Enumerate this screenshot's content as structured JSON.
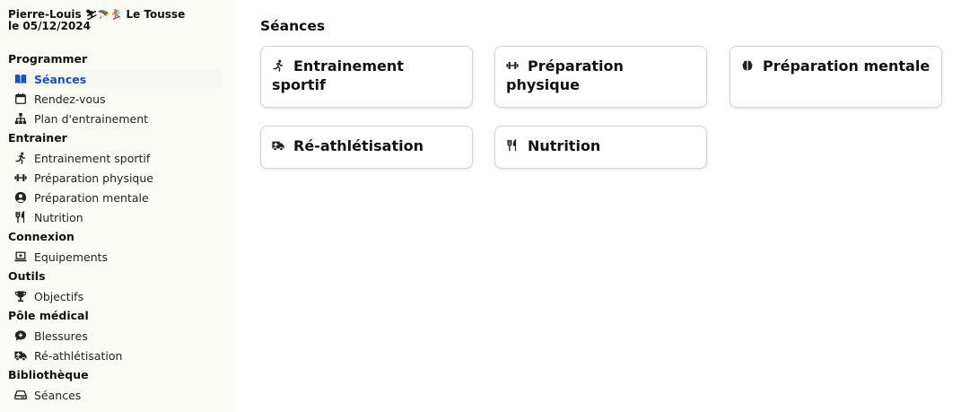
{
  "user": {
    "line1_name": "Pierre-Louis",
    "line1_emoji": "⛷🪂🏂",
    "line1_place": "Le Tousse",
    "line2": "le 05/12/2024"
  },
  "sidebar": {
    "sections": [
      {
        "title": "Programmer",
        "items": [
          {
            "label": "Séances",
            "icon": "book-icon",
            "active": true
          },
          {
            "label": "Rendez-vous",
            "icon": "calendar-icon"
          },
          {
            "label": "Plan d'entrainement",
            "icon": "sitemap-icon"
          }
        ]
      },
      {
        "title": "Entrainer",
        "items": [
          {
            "label": "Entrainement sportif",
            "icon": "running-icon"
          },
          {
            "label": "Préparation physique",
            "icon": "dumbbell-icon"
          },
          {
            "label": "Préparation mentale",
            "icon": "user-circle-icon"
          },
          {
            "label": "Nutrition",
            "icon": "utensils-icon"
          }
        ]
      },
      {
        "title": "Connexion",
        "items": [
          {
            "label": "Equipements",
            "icon": "laptop-icon"
          }
        ]
      },
      {
        "title": "Outils",
        "items": [
          {
            "label": "Objectifs",
            "icon": "trophy-icon"
          }
        ]
      },
      {
        "title": "Pôle médical",
        "items": [
          {
            "label": "Blessures",
            "icon": "comment-medical-icon"
          },
          {
            "label": "Ré-athlétisation",
            "icon": "ambulance-icon"
          }
        ]
      },
      {
        "title": "Bibliothèque",
        "items": [
          {
            "label": "Séances",
            "icon": "hdd-icon"
          }
        ]
      }
    ]
  },
  "main": {
    "title": "Séances",
    "cards": [
      {
        "label": "Entrainement sportif",
        "icon": "running-icon"
      },
      {
        "label": "Préparation physique",
        "icon": "dumbbell-icon"
      },
      {
        "label": "Préparation mentale",
        "icon": "brain-icon"
      },
      {
        "label": "Ré-athlétisation",
        "icon": "ambulance-icon"
      },
      {
        "label": "Nutrition",
        "icon": "utensils-icon"
      }
    ]
  },
  "colors": {
    "accent": "#1650c7",
    "sidebar_bg": "#fcfcf7",
    "card_border": "#d6d6d6"
  }
}
